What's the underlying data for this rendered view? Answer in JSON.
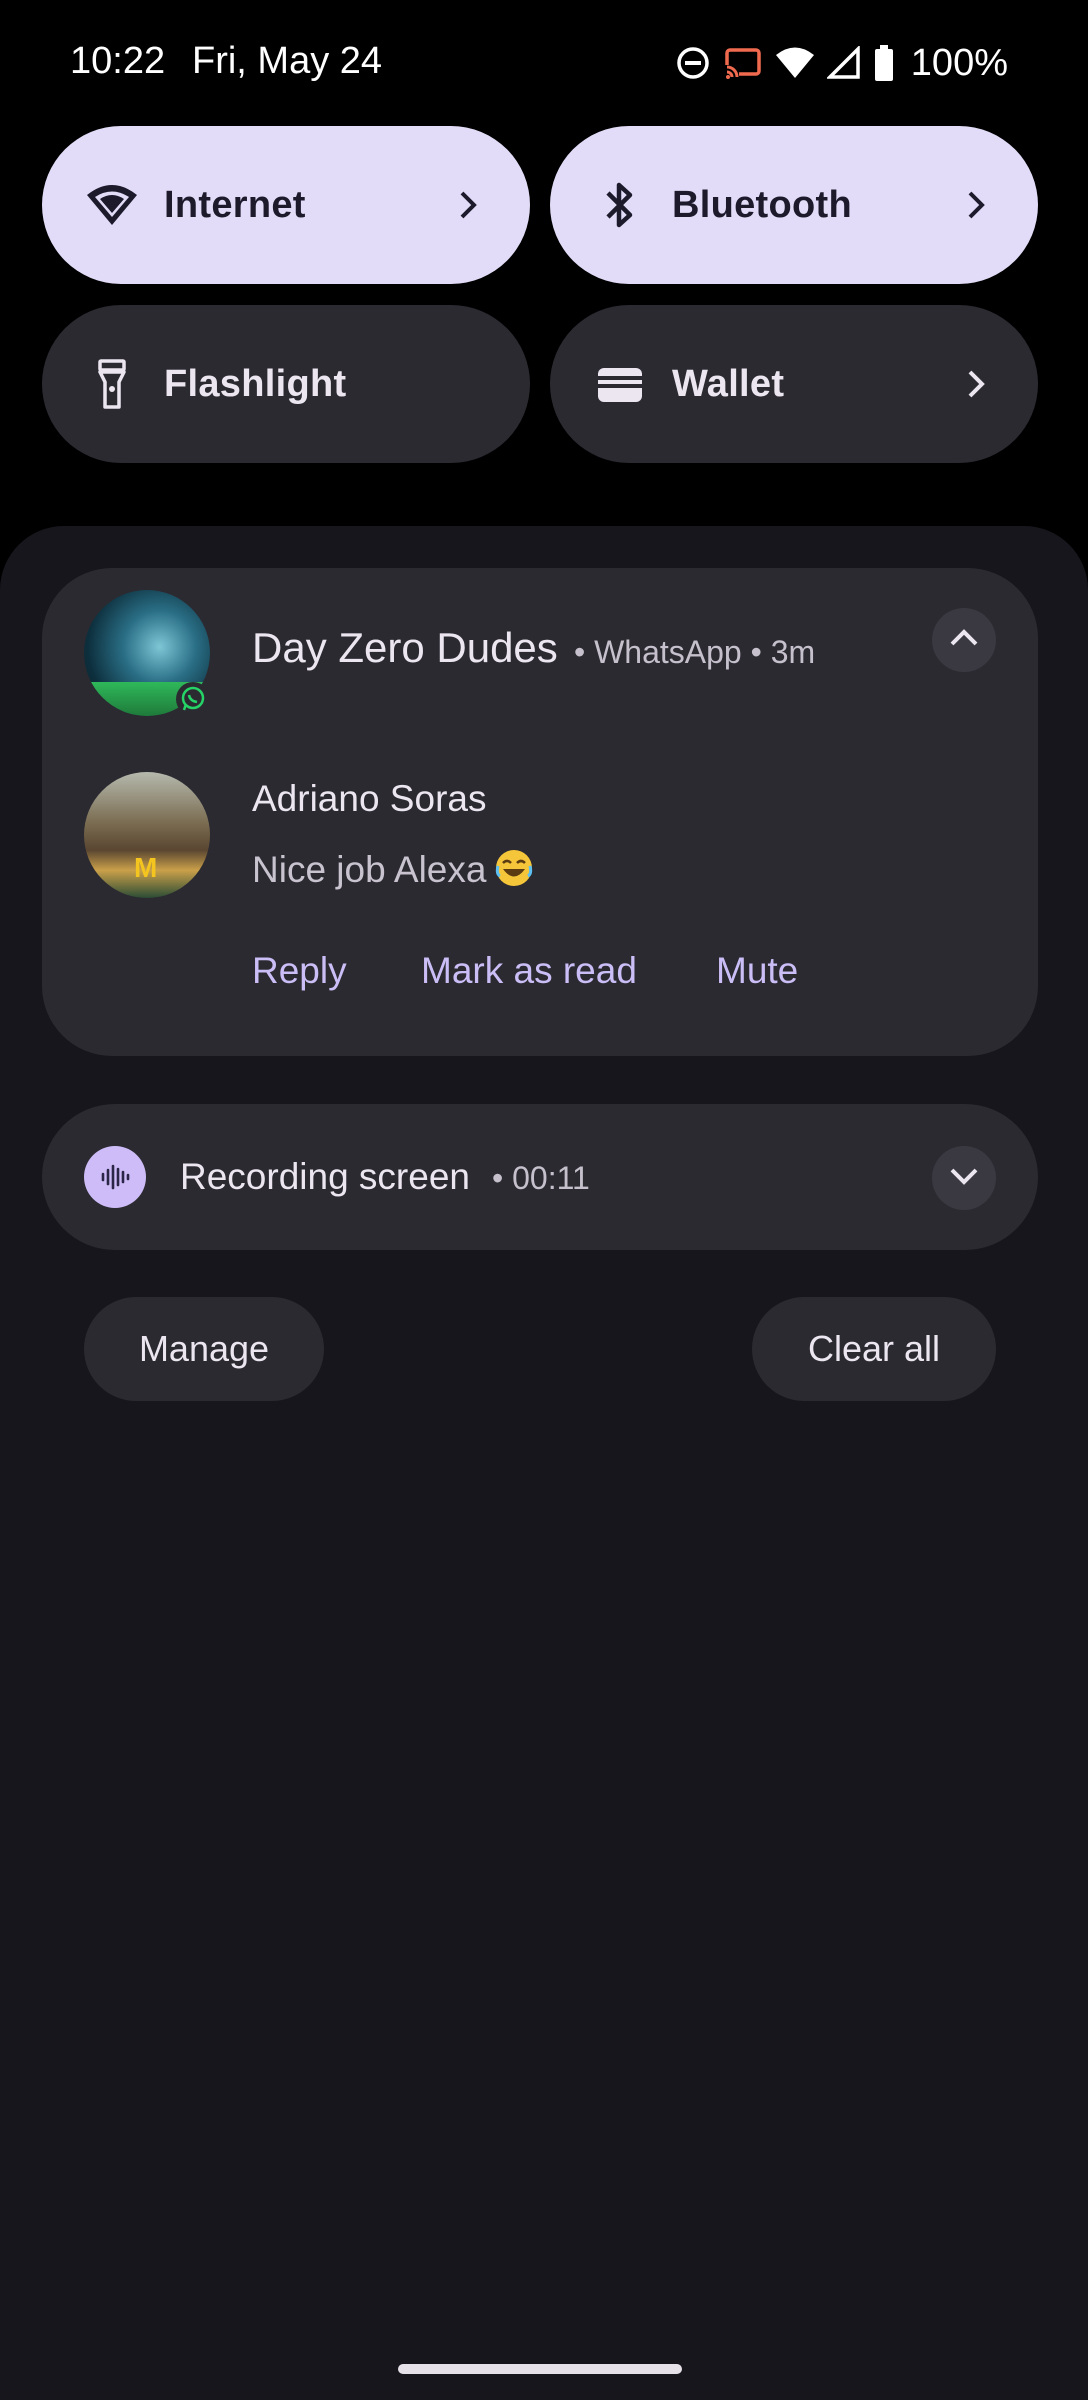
{
  "status_bar": {
    "time": "10:22",
    "date": "Fri, May 24",
    "battery": "100%",
    "icons": [
      "dnd-icon",
      "cast-icon",
      "wifi-icon",
      "signal-icon",
      "battery-icon"
    ]
  },
  "quick_tiles": [
    {
      "label": "Internet",
      "icon": "wifi-icon",
      "state": "on"
    },
    {
      "label": "Bluetooth",
      "icon": "bluetooth-icon",
      "state": "on"
    },
    {
      "label": "Flashlight",
      "icon": "flashlight-icon",
      "state": "off"
    },
    {
      "label": "Wallet",
      "icon": "wallet-icon",
      "state": "off"
    }
  ],
  "notification": {
    "title": "Day Zero Dudes",
    "app": "WhatsApp",
    "time": "3m",
    "sender": "Adriano Soras",
    "message": "Nice job Alexa",
    "actions": [
      "Reply",
      "Mark as read",
      "Mute"
    ]
  },
  "recording": {
    "title": "Recording screen",
    "elapsed": "00:11"
  },
  "buttons": {
    "manage": "Manage",
    "clear_all": "Clear all"
  },
  "colors": {
    "tile_on": "#e2dcf8",
    "tile_off": "#2b2a31",
    "accent_text": "#cbbef6",
    "shade_bg": "#17161c"
  }
}
